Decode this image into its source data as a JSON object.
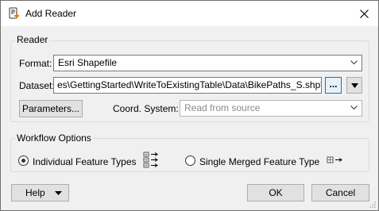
{
  "window": {
    "title": "Add Reader",
    "icon": "add-reader-icon",
    "close_icon": "close-icon"
  },
  "reader": {
    "group_label": "Reader",
    "format_label": "Format:",
    "format_value": "Esri Shapefile",
    "dataset_label": "Dataset:",
    "dataset_value": "es\\GettingStarted\\WriteToExistingTable\\Data\\BikePaths_S.shp\"",
    "browse_label": "...",
    "dropdown_arrow_icon": "triangle-down-icon",
    "parameters_label": "Parameters...",
    "coord_label": "Coord. System:",
    "coord_placeholder": "Read from source"
  },
  "workflow": {
    "group_label": "Workflow Options",
    "option_individual": "Individual Feature Types",
    "option_merged": "Single Merged Feature Type",
    "selected": "individual"
  },
  "footer": {
    "help_label": "Help",
    "ok_label": "OK",
    "cancel_label": "Cancel"
  },
  "colors": {
    "accent": "#0078d7",
    "border": "#adadad",
    "background": "#f0f0f0"
  }
}
